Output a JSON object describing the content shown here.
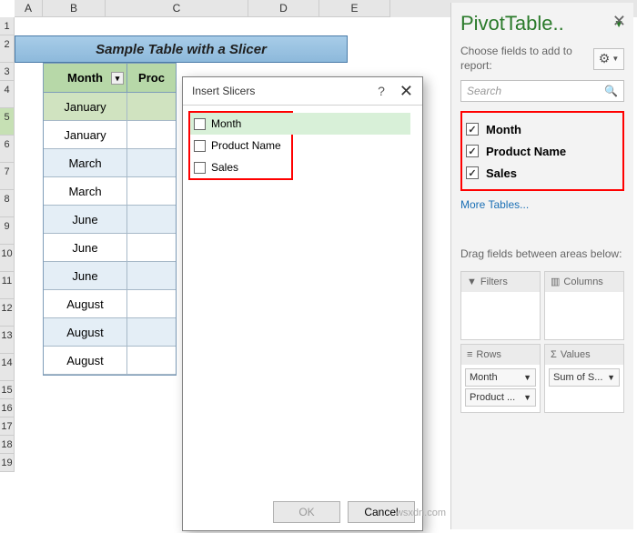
{
  "columns": [
    "A",
    "B",
    "C",
    "D",
    "E"
  ],
  "rows": [
    "1",
    "2",
    "3",
    "4",
    "5",
    "6",
    "7",
    "8",
    "9",
    "10",
    "11",
    "12",
    "13",
    "14",
    "15",
    "16",
    "17",
    "18",
    "19"
  ],
  "title_banner": "Sample Table with a Slicer",
  "table": {
    "headers": [
      "Month",
      "Proc"
    ],
    "rows": [
      "January",
      "January",
      "March",
      "March",
      "June",
      "June",
      "June",
      "August",
      "August",
      "August"
    ]
  },
  "dialog": {
    "title": "Insert Slicers",
    "items": [
      "Month",
      "Product Name",
      "Sales"
    ],
    "ok": "OK",
    "cancel": "Cancel"
  },
  "panel": {
    "title": "PivotTable..",
    "choose": "Choose fields to add to report:",
    "search_placeholder": "Search",
    "fields": [
      "Month",
      "Product Name",
      "Sales"
    ],
    "more_tables": "More Tables...",
    "drag_label": "Drag fields between areas below:",
    "filters": "Filters",
    "columns": "Columns",
    "rows_label": "Rows",
    "values": "Values",
    "row_pills": [
      "Month",
      "Product ..."
    ],
    "value_pills": [
      "Sum of S..."
    ]
  },
  "watermark": "wsxdn.com"
}
